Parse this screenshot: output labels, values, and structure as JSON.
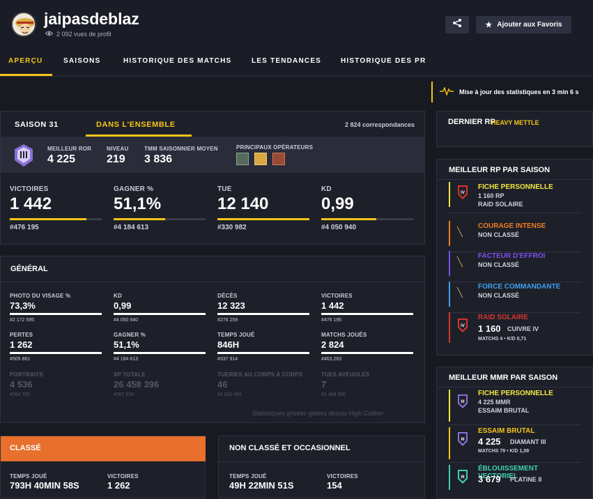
{
  "profile": {
    "username": "jaipasdeblaz",
    "views": "2 092 vues de profil"
  },
  "actions": {
    "favorite": "Ajouter aux Favoris"
  },
  "tabs": [
    "APERÇU",
    "SAISONS",
    "HISTORIQUE DES MATCHS",
    "LES TENDANCES",
    "HISTORIQUE DES PR"
  ],
  "update_notice": "Mise à jour des statistiques en 3 min 6 s",
  "season": {
    "tab_season": "SAISON 31",
    "tab_overall": "DANS L'ENSEMBLE",
    "matches": "2 824 correspondances",
    "best_ror_label": "MEILLEUR ROR",
    "best_ror": "4 225",
    "level_label": "NIVEAU",
    "level": "219",
    "tmm_label": "TMM SAISONNIER MOYEN",
    "tmm": "3 836",
    "operators_label": "PRINCIPAUX OPÉRATEURS",
    "stats": [
      {
        "label": "VICTOIRES",
        "value": "1 442",
        "rank": "#476 195",
        "progress": 0.83
      },
      {
        "label": "GAGNER %",
        "value": "51,1%",
        "rank": "#4 184 613",
        "progress": 0.56
      },
      {
        "label": "TUE",
        "value": "12 140",
        "rank": "#330 982",
        "progress": 1.0
      },
      {
        "label": "KD",
        "value": "0,99",
        "rank": "#4 050 940",
        "progress": 0.6
      }
    ]
  },
  "general": {
    "title": "GÉNÉRAL",
    "items": [
      {
        "label": "PHOTO DU VISAGE %",
        "value": "73,3%",
        "rank": "#2 172 595"
      },
      {
        "label": "KD",
        "value": "0,99",
        "rank": "#4 050 940"
      },
      {
        "label": "DÉCÈS",
        "value": "12 323",
        "rank": "#276 259"
      },
      {
        "label": "VICTOIRES",
        "value": "1 442",
        "rank": "#476 195"
      },
      {
        "label": "PERTES",
        "value": "1 262",
        "rank": "#505 861"
      },
      {
        "label": "GAGNER %",
        "value": "51,1%",
        "rank": "#4 184 613"
      },
      {
        "label": "TEMPS JOUÉ",
        "value": "846H",
        "rank": "#337 914"
      },
      {
        "label": "MATCHS JOUÉS",
        "value": "2 824",
        "rank": "#463,263"
      },
      {
        "label": "PORTRAITS",
        "value": "4 536",
        "rank": "#264 785"
      },
      {
        "label": "XP TOTALE",
        "value": "26 458 396",
        "rank": "#387 524"
      },
      {
        "label": "TUERIES AU CORPS À CORPS",
        "value": "46",
        "rank": "#1 822 491"
      },
      {
        "label": "TUES AVEUGLES",
        "value": "7",
        "rank": "#1 468 580"
      }
    ],
    "note": "Statistiques grisées gelées depuis High Caliber"
  },
  "ranked": {
    "title": "CLASSÉ",
    "time_label": "TEMPS JOUÉ",
    "time": "793H 40MIN 58S",
    "wins_label": "VICTOIRES",
    "wins": "1 262"
  },
  "unranked": {
    "title": "NON CLASSÉ ET OCCASIONNEL",
    "time_label": "TEMPS JOUÉ",
    "time": "49H 22MIN 51S",
    "wins_label": "VICTOIRES",
    "wins": "154"
  },
  "last_rp": {
    "title": "DERNIER RP",
    "season": "HEAVY METTLE"
  },
  "best_rp": {
    "title": "MEILLEUR RP PAR SAISON",
    "rows": [
      {
        "name": "FICHE PERSONNELLE",
        "line1": "1 160 RP",
        "line2": "RAID SOLAIRE",
        "color": "#f5e642"
      },
      {
        "name": "COURAGE INTENSE",
        "line1": "NON CLASSÉ",
        "color": "#f07c1c"
      },
      {
        "name": "FACTEUR D'EFFROI",
        "line1": "NON CLASSÉ",
        "color": "#7b4ff0"
      },
      {
        "name": "FORCE COMMANDANTE",
        "line1": "NON CLASSÉ",
        "color": "#3fa0f0"
      },
      {
        "name": "RAID SOLAIRE",
        "value": "1 160",
        "rank": "CUIVRE IV",
        "details": "MATCHS 4  •  K/D 0,71",
        "color": "#d8342c"
      }
    ]
  },
  "best_mmr": {
    "title": "MEILLEUR MMR PAR SAISON",
    "rows": [
      {
        "name": "FICHE PERSONNELLE",
        "line1": "4 225 MMR",
        "line2": "ESSAIM BRUTAL",
        "color": "#f5e642"
      },
      {
        "name": "ESSAIM BRUTAL",
        "value": "4 225",
        "rank": "DIAMANT III",
        "details": "MATCHS 79  •  K/D 1,09",
        "color": "#f5c518"
      },
      {
        "name": "ÉBLOUISSEMENT VECTORIEL",
        "value": "3 679",
        "rank": "PLATINE II",
        "color": "#3fd0b0"
      }
    ]
  }
}
